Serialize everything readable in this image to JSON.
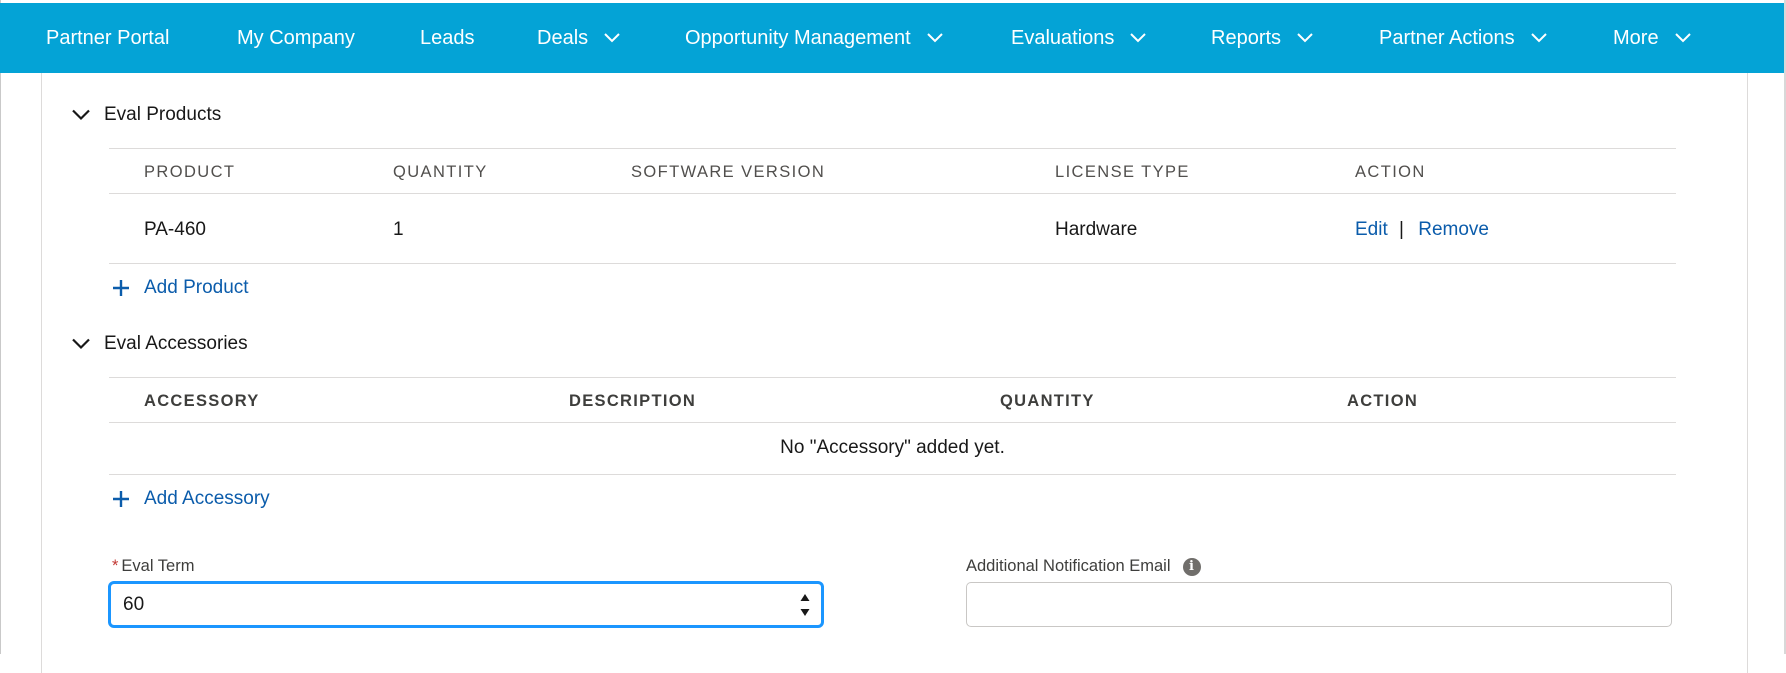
{
  "nav": {
    "items": [
      {
        "label": "Partner Portal",
        "dropdown": false
      },
      {
        "label": "My Company",
        "dropdown": false
      },
      {
        "label": "Leads",
        "dropdown": false
      },
      {
        "label": "Deals",
        "dropdown": true
      },
      {
        "label": "Opportunity Management",
        "dropdown": true
      },
      {
        "label": "Evaluations",
        "dropdown": true
      },
      {
        "label": "Reports",
        "dropdown": true
      },
      {
        "label": "Partner Actions",
        "dropdown": true
      },
      {
        "label": "More",
        "dropdown": true
      }
    ],
    "background_color": "#04a3d6"
  },
  "eval_products": {
    "title": "Eval Products",
    "columns": [
      "PRODUCT",
      "QUANTITY",
      "SOFTWARE VERSION",
      "LICENSE TYPE",
      "ACTION"
    ],
    "rows": [
      {
        "product": "PA-460",
        "quantity": "1",
        "software_version": "",
        "license_type": "Hardware",
        "edit_label": "Edit",
        "separator": "|",
        "remove_label": "Remove"
      }
    ],
    "add_label": "Add Product"
  },
  "eval_accessories": {
    "title": "Eval Accessories",
    "columns": [
      "ACCESSORY",
      "DESCRIPTION",
      "QUANTITY",
      "ACTION"
    ],
    "empty_message": "No \"Accessory\" added yet.",
    "add_label": "Add Accessory"
  },
  "form": {
    "eval_term": {
      "required_mark": "*",
      "label": "Eval Term",
      "value": "60"
    },
    "notification_email": {
      "label": "Additional Notification Email",
      "value": "",
      "info_icon": "info-icon"
    }
  },
  "colors": {
    "link": "#0b5cab",
    "focus": "#1b96ff",
    "required": "#c23934"
  }
}
